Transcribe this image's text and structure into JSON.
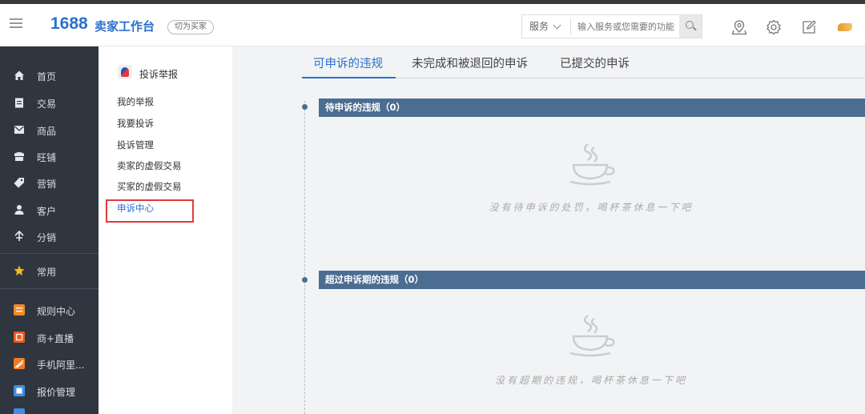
{
  "header": {
    "logo_num": "1688",
    "logo_text": "卖家工作台",
    "switch_label": "切为买家",
    "search": {
      "category": "服务",
      "placeholder": "输入服务或您需要的功能"
    }
  },
  "sidebar": {
    "items": [
      {
        "label": "首页",
        "icon": "home-icon"
      },
      {
        "label": "交易",
        "icon": "clipboard-icon"
      },
      {
        "label": "商品",
        "icon": "mail-icon"
      },
      {
        "label": "旺铺",
        "icon": "shop-icon"
      },
      {
        "label": "营销",
        "icon": "tag-icon"
      },
      {
        "label": "客户",
        "icon": "user-icon"
      },
      {
        "label": "分销",
        "icon": "share-icon"
      }
    ],
    "favorite": {
      "label": "常用",
      "icon": "star-icon"
    },
    "apps": [
      {
        "label": "规则中心",
        "icon": "rules-app-icon",
        "color": "#f08b2a"
      },
      {
        "label": "商+直播",
        "icon": "live-app-icon",
        "color": "#f25a1e"
      },
      {
        "label": "手机阿里...",
        "icon": "mobile-app-icon",
        "color": "#f07b22"
      },
      {
        "label": "报价管理",
        "icon": "quote-app-icon",
        "color": "#3f8ee8"
      }
    ]
  },
  "subnav": {
    "header": "投诉举报",
    "links": [
      "我的举报",
      "我要投诉",
      "投诉管理",
      "卖家的虚假交易",
      "买家的虚假交易",
      "申诉中心"
    ],
    "active_index": 5
  },
  "tabs": [
    "可申诉的违规",
    "未完成和被退回的申诉",
    "已提交的申诉"
  ],
  "sections": [
    {
      "title": "待申诉的违规（0）",
      "empty": "没有待申诉的处罚，喝杯茶休息一下吧"
    },
    {
      "title": "超过申诉期的违规（0）",
      "empty": "没有超期的违规，喝杯茶休息一下吧"
    }
  ],
  "colors": {
    "brand": "#2b6fd0",
    "sidebar": "#2f3640",
    "section_bar": "#4b6d92",
    "highlight": "#e23a3a"
  }
}
